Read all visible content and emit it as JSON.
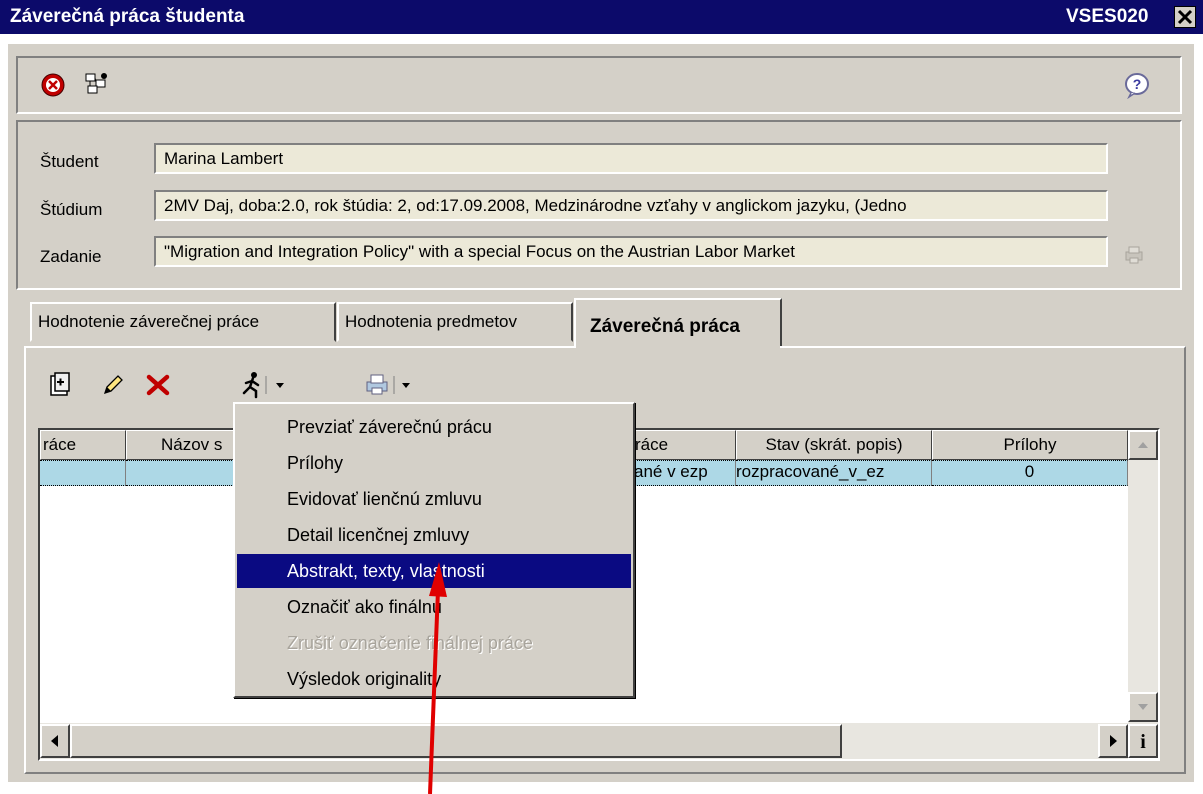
{
  "window": {
    "title": "Záverečná práca študenta",
    "code": "VSES020"
  },
  "toolbar": {
    "icons": [
      "close-red-icon",
      "tree-icon",
      "help-icon"
    ]
  },
  "info": {
    "student_label": "Študent",
    "student_value": "Marina Lambert",
    "studium_label": "Štúdium",
    "studium_value": "2MV Daj, doba:2.0, rok štúdia: 2, od:17.09.2008, Medzinárodne vzťahy v anglickom jazyku, (Jedno",
    "zadanie_label": "Zadanie",
    "zadanie_value": "\"Migration and Integration Policy\" with a special Focus on the Austrian Labor Market"
  },
  "tabs": [
    {
      "label": "Hodnotenie záverečnej práce"
    },
    {
      "label": "Hodnotenia predmetov"
    },
    {
      "label": "Záverečná práca"
    }
  ],
  "grid": {
    "headers": [
      "ráce",
      "Názov s",
      "ráce",
      "Stav (skrát. popis)",
      "Prílohy"
    ],
    "row": [
      "",
      "",
      "ané v ezp",
      "rozpracované_v_ez",
      "0"
    ]
  },
  "menu": {
    "items": [
      {
        "label": "Prevziať záverečnú prácu",
        "state": "normal"
      },
      {
        "label": "Prílohy",
        "state": "normal"
      },
      {
        "label": "Evidovať lienčnú zmluvu",
        "state": "normal"
      },
      {
        "label": "Detail licenčnej zmluvy",
        "state": "normal"
      },
      {
        "label": "Abstrakt, texty, vlastnosti",
        "state": "selected"
      },
      {
        "label": "Označiť ako finálnu",
        "state": "normal"
      },
      {
        "label": "Zrušiť označenie finálnej práce",
        "state": "disabled"
      },
      {
        "label": "Výsledok originality",
        "state": "normal"
      }
    ]
  },
  "colors": {
    "titlebar": "#0c0a6a",
    "window_bg": "#d4d0c8",
    "selection": "#0a0a82",
    "grid_row": "#add8e6",
    "arrow": "#e00000"
  }
}
